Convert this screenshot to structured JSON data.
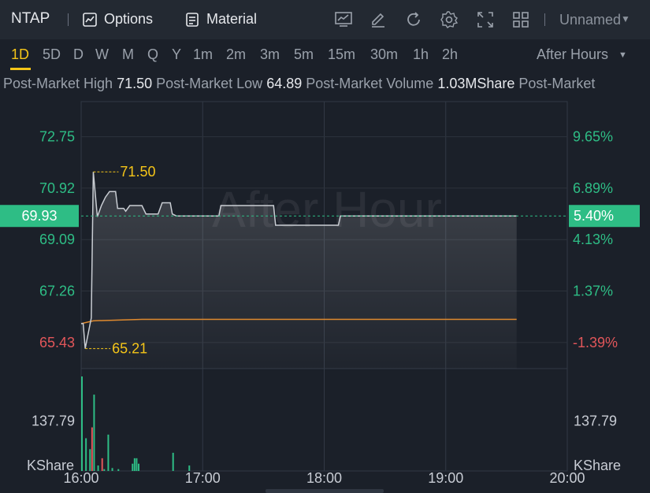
{
  "toolbar": {
    "symbol": "NTAP",
    "options_label": "Options",
    "material_label": "Material",
    "layout_name": "Unnamed",
    "icons": [
      "options-icon",
      "material-icon",
      "chart-type-icon",
      "draw-icon",
      "refresh-icon",
      "settings-icon",
      "fullscreen-icon",
      "grid-layout-icon"
    ]
  },
  "timeframes": [
    "1D",
    "5D",
    "D",
    "W",
    "M",
    "Q",
    "Y",
    "1m",
    "2m",
    "3m",
    "5m",
    "15m",
    "30m",
    "1h",
    "2h"
  ],
  "active_timeframe": "1D",
  "session_label": "After Hours",
  "info": {
    "high_label": "Post-Market High",
    "high_value": "71.50",
    "low_label": "Post-Market Low",
    "low_value": "64.89",
    "volume_label": "Post-Market Volume",
    "volume_value": "1.03MShare",
    "tail_label": "Post-Market"
  },
  "watermark": "After Hour",
  "chart_data": {
    "type": "line",
    "x_range": [
      "16:00",
      "20:00"
    ],
    "x_ticks": [
      "16:00",
      "17:00",
      "18:00",
      "19:00",
      "20:00"
    ],
    "price_axis": {
      "ticks": [
        72.75,
        70.92,
        69.09,
        67.26,
        65.43
      ],
      "tick_labels": [
        "72.75",
        "70.92",
        "69.09",
        "67.26",
        "65.43"
      ],
      "range": [
        64.5,
        74.0
      ]
    },
    "percent_axis": {
      "ticks": [
        9.65,
        6.89,
        4.13,
        1.37,
        -1.39
      ],
      "tick_labels": [
        "9.65%",
        "6.89%",
        "4.13%",
        "1.37%",
        "-1.39%"
      ]
    },
    "current_price": "69.93",
    "current_percent": "5.40%",
    "high_marker": "71.50",
    "low_marker": "65.21",
    "price_series": [
      {
        "t": "16:00",
        "v": 66.1
      },
      {
        "t": "16:01",
        "v": 66.1
      },
      {
        "t": "16:02",
        "v": 65.21
      },
      {
        "t": "16:05",
        "v": 66.3
      },
      {
        "t": "16:06",
        "v": 71.5
      },
      {
        "t": "16:08",
        "v": 69.9
      },
      {
        "t": "16:10",
        "v": 70.3
      },
      {
        "t": "16:12",
        "v": 70.6
      },
      {
        "t": "16:14",
        "v": 70.8
      },
      {
        "t": "16:17",
        "v": 70.8
      },
      {
        "t": "16:18",
        "v": 70.2
      },
      {
        "t": "16:21",
        "v": 70.2
      },
      {
        "t": "16:22",
        "v": 70.1
      },
      {
        "t": "16:24",
        "v": 70.3
      },
      {
        "t": "16:30",
        "v": 70.3
      },
      {
        "t": "16:32",
        "v": 70.0
      },
      {
        "t": "16:38",
        "v": 70.0
      },
      {
        "t": "16:40",
        "v": 70.4
      },
      {
        "t": "16:44",
        "v": 70.4
      },
      {
        "t": "16:45",
        "v": 70.0
      },
      {
        "t": "16:47",
        "v": 69.93
      },
      {
        "t": "17:08",
        "v": 69.93
      },
      {
        "t": "17:09",
        "v": 70.3
      },
      {
        "t": "17:35",
        "v": 70.3
      },
      {
        "t": "17:36",
        "v": 69.6
      },
      {
        "t": "18:07",
        "v": 69.6
      },
      {
        "t": "18:08",
        "v": 69.93
      },
      {
        "t": "19:35",
        "v": 69.93
      }
    ],
    "avg_series": [
      {
        "t": "16:00",
        "v": 66.1
      },
      {
        "t": "16:06",
        "v": 66.2
      },
      {
        "t": "16:30",
        "v": 66.25
      },
      {
        "t": "19:35",
        "v": 66.25
      }
    ],
    "volume": {
      "tick_label": "137.79",
      "unit_label": "KShare",
      "max": 260,
      "bars": [
        {
          "t": "16:00",
          "v": 260,
          "c": "up"
        },
        {
          "t": "16:02",
          "v": 90,
          "c": "up"
        },
        {
          "t": "16:04",
          "v": 60,
          "c": "up"
        },
        {
          "t": "16:05",
          "v": 120,
          "c": "down"
        },
        {
          "t": "16:06",
          "v": 210,
          "c": "up"
        },
        {
          "t": "16:08",
          "v": 15,
          "c": "up"
        },
        {
          "t": "16:10",
          "v": 35,
          "c": "down"
        },
        {
          "t": "16:11",
          "v": 5,
          "c": "up"
        },
        {
          "t": "16:13",
          "v": 100,
          "c": "up"
        },
        {
          "t": "16:15",
          "v": 8,
          "c": "up"
        },
        {
          "t": "16:18",
          "v": 5,
          "c": "up"
        },
        {
          "t": "16:25",
          "v": 20,
          "c": "up"
        },
        {
          "t": "16:26",
          "v": 35,
          "c": "up"
        },
        {
          "t": "16:27",
          "v": 35,
          "c": "up"
        },
        {
          "t": "16:28",
          "v": 20,
          "c": "up"
        },
        {
          "t": "16:45",
          "v": 50,
          "c": "up"
        },
        {
          "t": "16:53",
          "v": 15,
          "c": "up"
        }
      ]
    }
  },
  "colors": {
    "up": "#2ebd85",
    "down": "#e2565a",
    "price_line": "#c9cdd3",
    "avg_line": "#e08a2e",
    "marker": "#f5c518",
    "current_badge": "#2ebd85"
  }
}
